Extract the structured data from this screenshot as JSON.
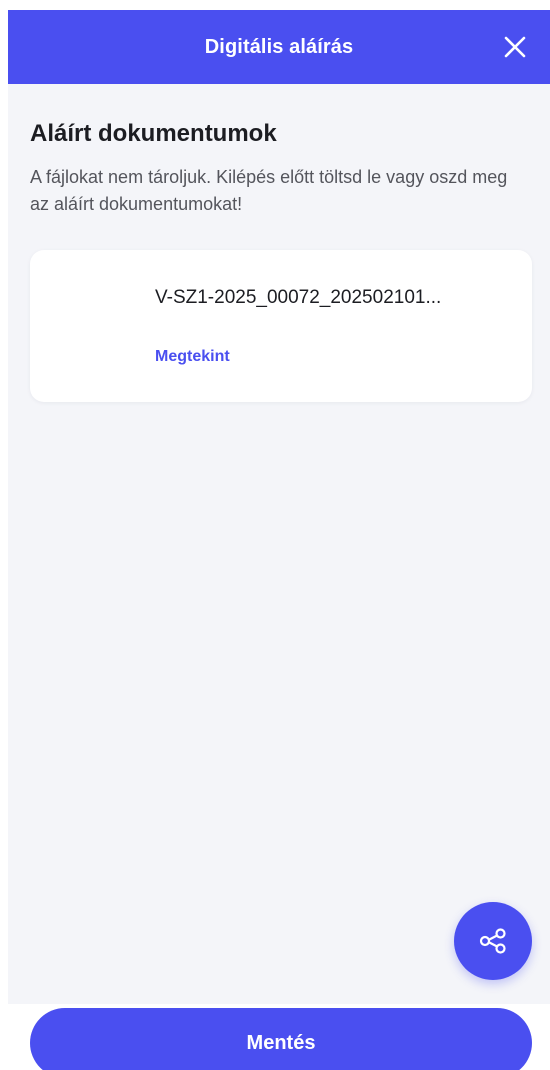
{
  "header": {
    "title": "Digitális aláírás",
    "close_icon": "close-icon",
    "background_color": "#4a4ff0"
  },
  "main": {
    "title": "Aláírt dokumentumok",
    "subtitle": "A fájlokat nem tároljuk. Kilépés előtt töltsd le vagy oszd meg az aláírt dokumentumokat!",
    "documents": [
      {
        "name": "V-SZ1-2025_00072_202502101...",
        "view_label": "Megtekint"
      }
    ]
  },
  "share_fab": {
    "icon": "share-icon"
  },
  "footer": {
    "save_label": "Mentés"
  },
  "colors": {
    "accent": "#4a4ff0",
    "background": "#f4f5f9",
    "text_primary": "#1c1d22",
    "text_secondary": "#54555c"
  }
}
